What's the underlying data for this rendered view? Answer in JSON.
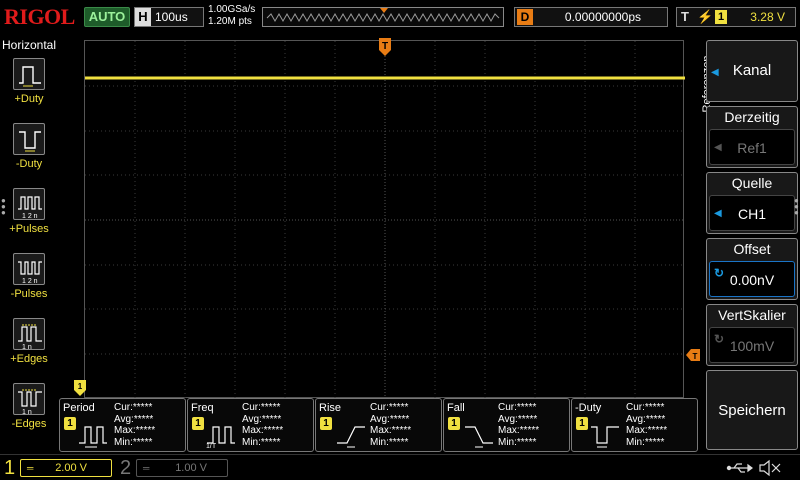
{
  "brand": {
    "logo": "RIGOL"
  },
  "topbar": {
    "auto_label": "AUTO",
    "horizontal": {
      "label": "H",
      "timebase": "100us"
    },
    "sampling": {
      "rate": "1.00GSa/s",
      "memory": "1.20M pts"
    },
    "delay": {
      "label": "D",
      "value": "0.00000000ps"
    },
    "trigger": {
      "label": "T",
      "source": "1",
      "level": "3.28 V",
      "edge_icon": "rising-edge-icon"
    }
  },
  "left_menu": {
    "title": "Horizontal",
    "items": [
      {
        "label": "+Duty",
        "icon": "positive-duty-icon"
      },
      {
        "label": "-Duty",
        "icon": "negative-duty-icon"
      },
      {
        "label": "+Pulses",
        "icon": "positive-pulses-icon"
      },
      {
        "label": "-Pulses",
        "icon": "negative-pulses-icon"
      },
      {
        "label": "+Edges",
        "icon": "positive-edges-icon"
      },
      {
        "label": "-Edges",
        "icon": "negative-edges-icon"
      }
    ]
  },
  "measurements": [
    {
      "name": "Period",
      "channel": "1",
      "cur": "Cur:*****",
      "avg": "Avg:*****",
      "max": "Max:*****",
      "min": "Min:*****",
      "icon": "period-icon"
    },
    {
      "name": "Freq",
      "channel": "1",
      "cur": "Cur:*****",
      "avg": "Avg:*****",
      "max": "Max:*****",
      "min": "Min:*****",
      "icon": "frequency-icon"
    },
    {
      "name": "Rise",
      "channel": "1",
      "cur": "Cur:*****",
      "avg": "Avg:*****",
      "max": "Max:*****",
      "min": "Min:*****",
      "icon": "rise-time-icon"
    },
    {
      "name": "Fall",
      "channel": "1",
      "cur": "Cur:*****",
      "avg": "Avg:*****",
      "max": "Max:*****",
      "min": "Min:*****",
      "icon": "fall-time-icon"
    },
    {
      "name": "-Duty",
      "channel": "1",
      "cur": "Cur:*****",
      "avg": "Avg:*****",
      "max": "Max:*****",
      "min": "Min:*****",
      "icon": "negative-duty-icon"
    }
  ],
  "right_menu": {
    "vertical_label": "Referenzen",
    "kanal": {
      "label": "Kanal"
    },
    "derzeitig": {
      "title": "Derzeitig",
      "value": "Ref1"
    },
    "quelle": {
      "title": "Quelle",
      "value": "CH1"
    },
    "offset": {
      "title": "Offset",
      "value": "0.00nV"
    },
    "vertskalier": {
      "title": "VertSkalier",
      "value": "100mV"
    },
    "speichern": {
      "label": "Speichern"
    }
  },
  "bottombar": {
    "ch1": {
      "number": "1",
      "scale": "2.00 V",
      "coupling_icon": "dc-coupling-icon"
    },
    "ch2": {
      "number": "2",
      "scale": "1.00 V",
      "coupling_icon": "dc-coupling-icon"
    },
    "status_icons": [
      "usb-icon",
      "speaker-muted-icon"
    ]
  },
  "colors": {
    "ch1": "#f0e040",
    "trigger": "#e87c14",
    "brand": "#e01b1b",
    "accent": "#1a74c7"
  }
}
